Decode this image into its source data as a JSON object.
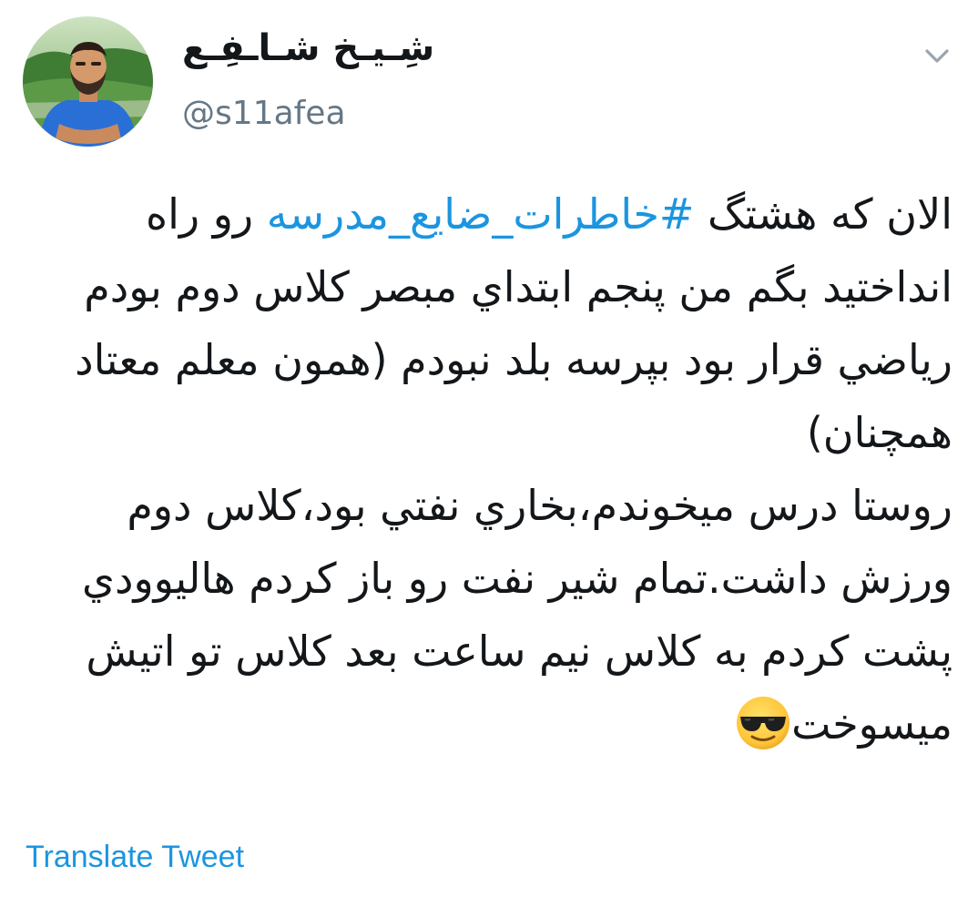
{
  "tweet": {
    "author": {
      "display_name": "شِـيـخ شـاـفِـع",
      "handle": "@s11afea",
      "avatar_icon": "profile-photo"
    },
    "menu_icon": "chevron-down-icon",
    "body": {
      "line1_before": "الان كه هشتگ ",
      "hashtag": "#خاطرات_ضایع_مدرسه",
      "line1_after": " رو راه انداختيد بگم من پنجم ابتداي مبصر كلاس دوم بودم رياضي قرار بود بپرسه بلد نبودم (همون معلم معتاد همچنان)",
      "paragraph2": "روستا درس ميخوندم،بخاري نفتي بود،كلاس دوم ورزش داشت.تمام شير نفت رو باز كردم هاليوودي پشت كردم به كلاس نيم ساعت بعد كلاس تو اتيش ميسوخت",
      "emoji": "smiling-face-with-sunglasses"
    },
    "translate_label": "Translate Tweet"
  },
  "colors": {
    "link": "#1b95e0",
    "text": "#14171a",
    "secondary": "#657786",
    "chevron": "#9aa5ad"
  }
}
